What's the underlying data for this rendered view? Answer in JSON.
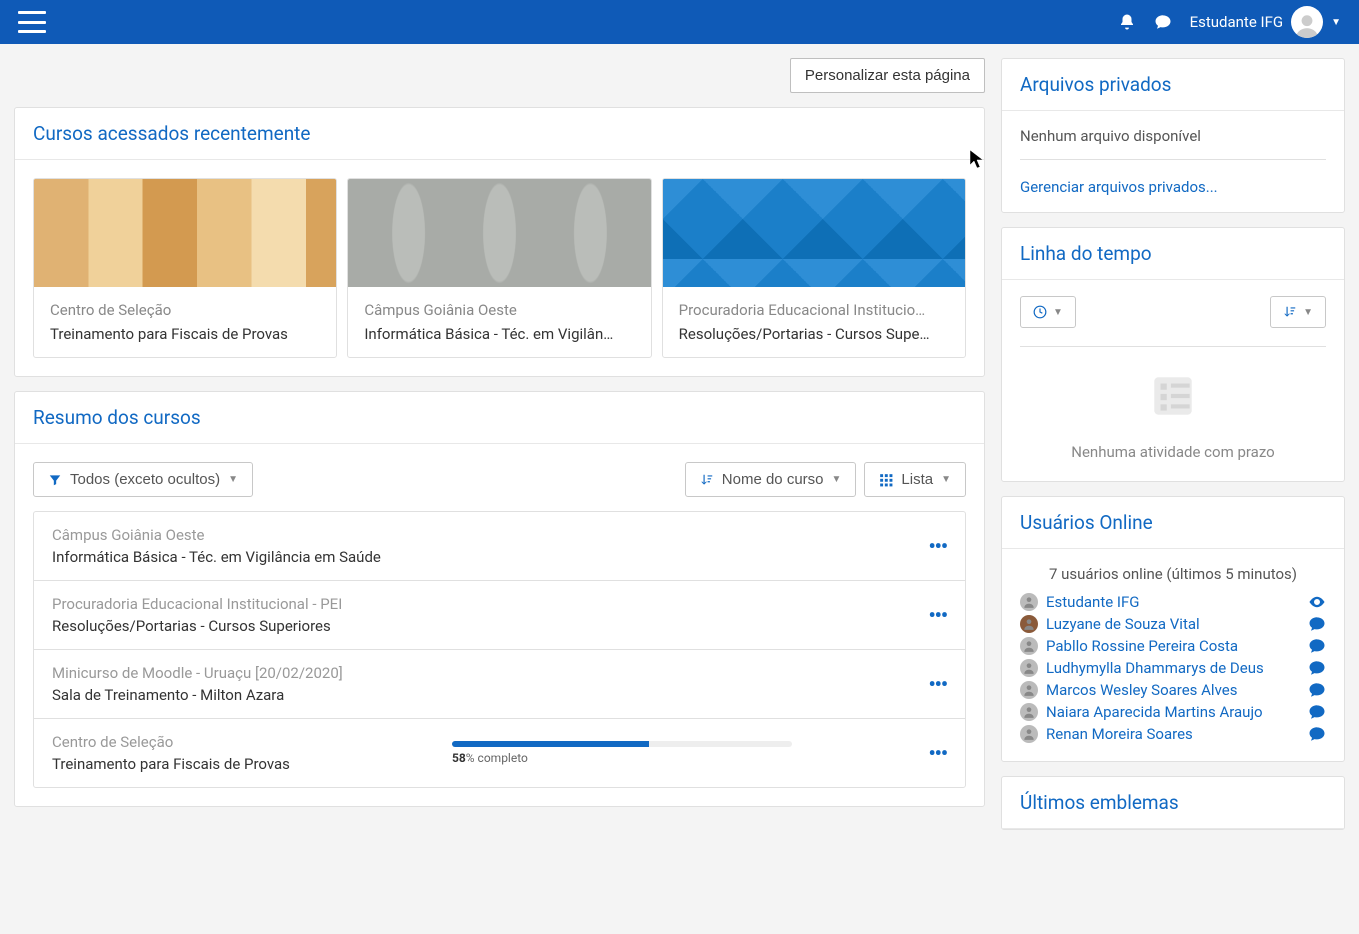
{
  "header": {
    "user_name": "Estudante IFG",
    "customize_btn": "Personalizar esta página"
  },
  "recent": {
    "title": "Cursos acessados recentemente",
    "cards": [
      {
        "category": "Centro de Seleção",
        "name": "Treinamento para Fiscais de Provas"
      },
      {
        "category": "Câmpus Goiânia Oeste",
        "name": "Informática Básica - Téc. em Vigilân…"
      },
      {
        "category": "Procuradoria Educacional Institucio…",
        "name": "Resoluções/Portarias - Cursos Supe…"
      }
    ]
  },
  "overview": {
    "title": "Resumo dos cursos",
    "filter_label": "Todos (exceto ocultos)",
    "sort_label": "Nome do curso",
    "view_label": "Lista",
    "rows": [
      {
        "category": "Câmpus Goiânia Oeste",
        "name": "Informática Básica - Téc. em Vigilância em Saúde"
      },
      {
        "category": "Procuradoria Educacional Institucional - PEI",
        "name": "Resoluções/Portarias - Cursos Superiores"
      },
      {
        "category": "Minicurso de Moodle - Uruaçu [20/02/2020]",
        "name": "Sala de Treinamento - Milton Azara"
      },
      {
        "category": "Centro de Seleção",
        "name": "Treinamento para Fiscais de Provas",
        "progress": 58,
        "progress_suffix": "% completo"
      }
    ]
  },
  "private_files": {
    "title": "Arquivos privados",
    "empty": "Nenhum arquivo disponível",
    "manage_link": "Gerenciar arquivos privados..."
  },
  "timeline": {
    "title": "Linha do tempo",
    "empty": "Nenhuma atividade com prazo"
  },
  "online": {
    "title": "Usuários Online",
    "count": "7 usuários online (últimos 5 minutos)",
    "users": [
      {
        "name": "Estudante IFG",
        "action": "eye"
      },
      {
        "name": "Luzyane de Souza Vital",
        "action": "chat",
        "pic": true
      },
      {
        "name": "Pabllo Rossine Pereira Costa",
        "action": "chat"
      },
      {
        "name": "Ludhymylla Dhammarys de Deus",
        "action": "chat"
      },
      {
        "name": "Marcos Wesley Soares Alves",
        "action": "chat"
      },
      {
        "name": "Naiara Aparecida Martins Araujo",
        "action": "chat"
      },
      {
        "name": "Renan Moreira Soares",
        "action": "chat"
      }
    ]
  },
  "badges": {
    "title": "Últimos emblemas"
  }
}
